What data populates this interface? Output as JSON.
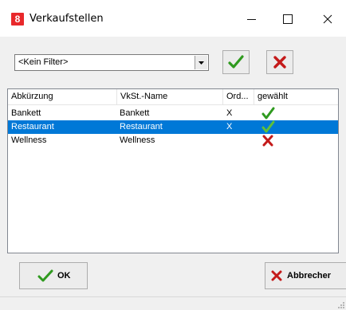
{
  "window": {
    "title": "Verkaufstellen",
    "app_icon_text": "8",
    "accent": "#e8282b"
  },
  "toolbar": {
    "filter": {
      "value": "<Kein Filter>"
    },
    "ok_icon": "check-icon",
    "cancel_icon": "x-icon"
  },
  "list": {
    "columns": [
      "Abkürzung",
      "VkSt.-Name",
      "Ord...",
      "gewählt"
    ],
    "rows": [
      {
        "abkuerzung": "Bankett",
        "name": "Bankett",
        "ord": "X",
        "gewaehlt": "check",
        "selected": false
      },
      {
        "abkuerzung": "Restaurant",
        "name": "Restaurant",
        "ord": "X",
        "gewaehlt": "check",
        "selected": true
      },
      {
        "abkuerzung": "Wellness",
        "name": "Wellness",
        "ord": "",
        "gewaehlt": "cross",
        "selected": false
      }
    ],
    "selection_color": "#0078d7"
  },
  "buttons": {
    "ok_label": "OK",
    "cancel_label": "Abbrecher"
  },
  "colors": {
    "check": "#2f9a1f",
    "cross": "#c41a1a"
  }
}
